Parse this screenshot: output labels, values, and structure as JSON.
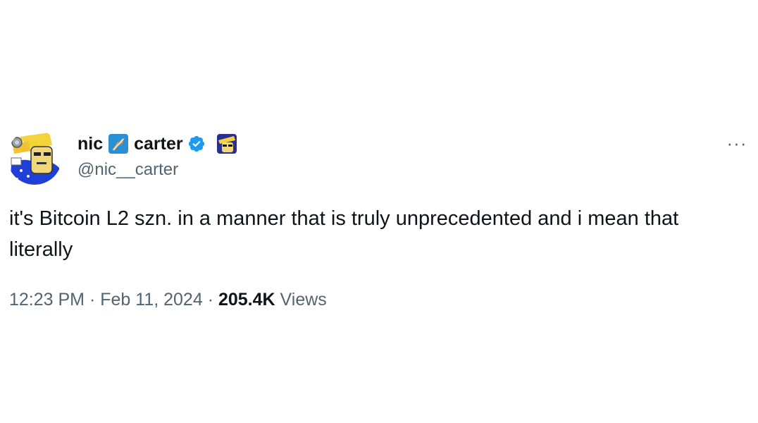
{
  "author": {
    "name_first": "nic",
    "name_last": "carter",
    "handle": "@nic__carter",
    "name_emoji_1": "orange-lightning-square-icon",
    "name_emoji_2": "sunglasses-character-icon",
    "verified_badge_color": "#1d9bf0"
  },
  "more_menu": {
    "label": "···"
  },
  "tweet": {
    "text": "it's Bitcoin L2 szn. in a manner that is truly unprecedented and i mean that literally",
    "time": "12:23 PM",
    "separator_1": "·",
    "date": "Feb 11, 2024",
    "separator_2": "·",
    "views_count": "205.4K",
    "views_label": "Views"
  },
  "colors": {
    "text_primary": "#0f1419",
    "text_secondary": "#536471",
    "verified_blue": "#1d9bf0"
  }
}
